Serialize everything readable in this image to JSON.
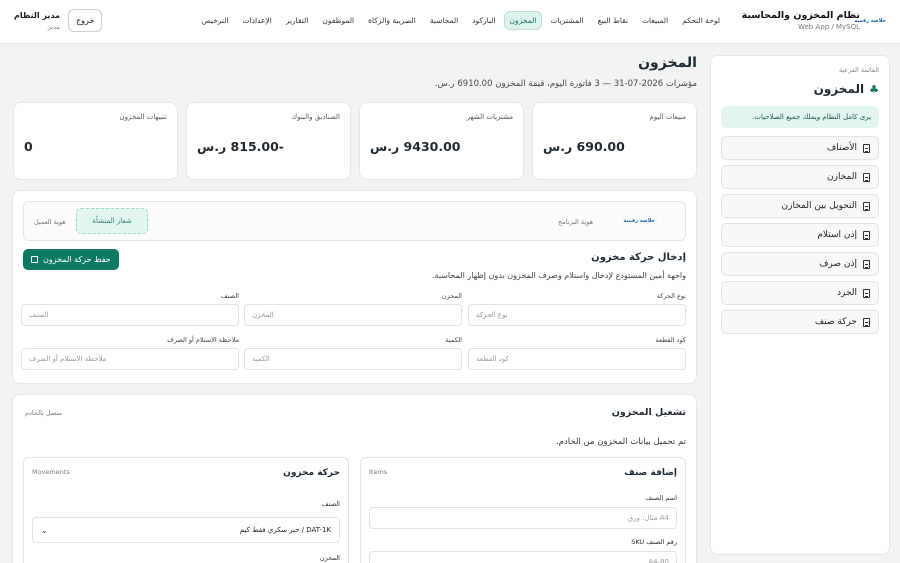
{
  "app": {
    "title": "نظام المخزون والمحاسبة",
    "subtitle": "Web App / MySQL",
    "logo_text": "خلاصة رقمية"
  },
  "nav": {
    "items": [
      "لوحة التحكم",
      "المبيعات",
      "نقاط البيع",
      "المشتريات",
      "المخزون",
      "الباركود",
      "المحاسبة",
      "الضريبة والزكاة",
      "الموظفون",
      "التقارير",
      "الإعدادات",
      "الترخيص"
    ],
    "active": "المخزون"
  },
  "user": {
    "name": "مدير النظام",
    "role": "مدير",
    "logout_label": "خروج"
  },
  "sidebar": {
    "small_label": "القائمة الفرعية",
    "title": "المخزون",
    "note": "يرى كامل النظام ويملك جميع الصلاحيات.",
    "items": [
      "الأصناف",
      "المخازن",
      "التحويل بين المخازن",
      "إذن استلام",
      "إذن صرف",
      "الجرد",
      "حركة صنف"
    ]
  },
  "page": {
    "title": "المخزون",
    "subtitle": "مؤشرات 2026-07-31 — 3 فاتورة اليوم، قيمة المخزون 6910.00 ر.س."
  },
  "stats": [
    {
      "label": "مبيعات اليوم",
      "value": "690.00 ر.س"
    },
    {
      "label": "مشتريات الشهر",
      "value": "9430.00 ر.س"
    },
    {
      "label": "الصناديق والبنوك",
      "value": "-815.00 ر.س"
    },
    {
      "label": "تنبيهات المخزون",
      "value": "0"
    }
  ],
  "identity": {
    "program_label": "هوية البرنامج",
    "client_label": "هوية العميل",
    "emblem": "شعار المنشأة"
  },
  "movement_form": {
    "title": "إدخال حركة مخزون",
    "subtitle": "واجهة أمين المستودع لإدخال واستلام وصرف المخزون بدون إظهار المحاسبة.",
    "save_label": "حفظ حركة المخزون",
    "fields": [
      {
        "label": "نوع الحركة",
        "placeholder": "نوع الحركة"
      },
      {
        "label": "المخزن",
        "placeholder": "المخزن"
      },
      {
        "label": "الصنف",
        "placeholder": "الصنف"
      },
      {
        "label": "كود القطعة",
        "placeholder": "كود القطعة"
      },
      {
        "label": "الكمية",
        "placeholder": "الكمية"
      },
      {
        "label": "ملاحظة الاستلام أو الصرف",
        "placeholder": "ملاحظة الاستلام أو الصرف"
      }
    ]
  },
  "operation": {
    "title": "تشغيل المخزون",
    "status": "متصل بالخادم",
    "message": "تم تحميل بيانات المخزون من الخادم.",
    "add_item": {
      "title": "إضافة صنف",
      "tag": "Items",
      "name_label": "اسم الصنف",
      "name_placeholder": "مثال: ورق A4",
      "sku_label": "رقم الصنف SKU",
      "sku_placeholder": "A4-80"
    },
    "movement": {
      "title": "حركة مخزون",
      "tag": "Movements",
      "item_label": "الصنف",
      "item_selected": "DAT-1K / حبر سكري فقط كيم",
      "warehouse_label": "المخزن"
    }
  }
}
